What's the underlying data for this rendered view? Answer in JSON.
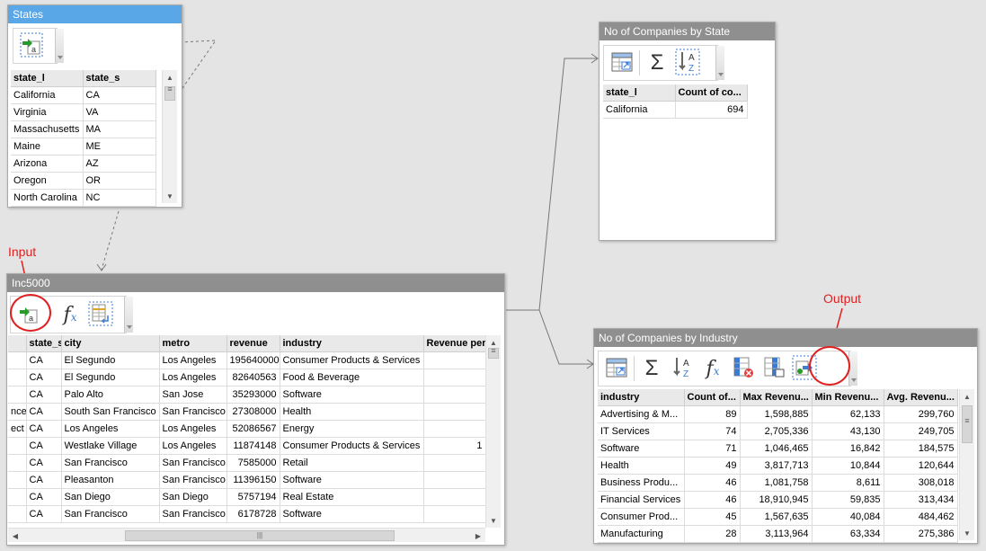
{
  "states_panel": {
    "title": "States",
    "columns": [
      "state_l",
      "state_s"
    ],
    "rows": [
      [
        "California",
        "CA"
      ],
      [
        "Virginia",
        "VA"
      ],
      [
        "Massachusetts",
        "MA"
      ],
      [
        "Maine",
        "ME"
      ],
      [
        "Arizona",
        "AZ"
      ],
      [
        "Oregon",
        "OR"
      ],
      [
        "North Carolina",
        "NC"
      ]
    ]
  },
  "inc_panel": {
    "title": "Inc5000",
    "columns": [
      "",
      "state_s",
      "city",
      "metro",
      "revenue",
      "industry",
      "Revenue per"
    ],
    "rows": [
      [
        "",
        "CA",
        "El Segundo",
        "Los Angeles",
        "195640000",
        "Consumer Products & Services",
        ""
      ],
      [
        "",
        "CA",
        "El Segundo",
        "Los Angeles",
        "82640563",
        "Food & Beverage",
        ""
      ],
      [
        "",
        "CA",
        "Palo Alto",
        "San Jose",
        "35293000",
        "Software",
        ""
      ],
      [
        "nce",
        "CA",
        "South San Francisco",
        "San Francisco",
        "27308000",
        "Health",
        ""
      ],
      [
        "ect",
        "CA",
        "Los Angeles",
        "Los Angeles",
        "52086567",
        "Energy",
        ""
      ],
      [
        "",
        "CA",
        "Westlake Village",
        "Los Angeles",
        "11874148",
        "Consumer Products & Services",
        "1"
      ],
      [
        "",
        "CA",
        "San Francisco",
        "San Francisco",
        "7585000",
        "Retail",
        ""
      ],
      [
        "",
        "CA",
        "Pleasanton",
        "San Francisco",
        "11396150",
        "Software",
        ""
      ],
      [
        "",
        "CA",
        "San Diego",
        "San Diego",
        "5757194",
        "Real Estate",
        ""
      ],
      [
        "",
        "CA",
        "San Francisco",
        "San Francisco",
        "6178728",
        "Software",
        ""
      ]
    ],
    "scroll_grip": "|||"
  },
  "by_state_panel": {
    "title": "No of Companies by State",
    "columns": [
      "state_l",
      "Count of co..."
    ],
    "rows": [
      [
        "California",
        "694"
      ]
    ]
  },
  "by_industry_panel": {
    "title": "No of Companies by Industry",
    "columns": [
      "industry",
      "Count of...",
      "Max Revenu...",
      "Min Revenu...",
      "Avg. Revenu..."
    ],
    "rows": [
      [
        "Advertising & M...",
        "89",
        "1,598,885",
        "62,133",
        "299,760"
      ],
      [
        "IT Services",
        "74",
        "2,705,336",
        "43,130",
        "249,705"
      ],
      [
        "Software",
        "71",
        "1,046,465",
        "16,842",
        "184,575"
      ],
      [
        "Health",
        "49",
        "3,817,713",
        "10,844",
        "120,644"
      ],
      [
        "Business Produ...",
        "46",
        "1,081,758",
        "8,611",
        "308,018"
      ],
      [
        "Financial Services",
        "46",
        "18,910,945",
        "59,835",
        "313,434"
      ],
      [
        "Consumer Prod...",
        "45",
        "1,567,635",
        "40,084",
        "484,462"
      ],
      [
        "Manufacturing",
        "28",
        "3,113,964",
        "63,334",
        "275,386"
      ]
    ]
  },
  "annotations": {
    "input_label": "Input",
    "output_label": "Output"
  },
  "icons": {
    "sigma": "Σ",
    "fx": "f",
    "fx_sub": "x",
    "sort_a": "A",
    "sort_z": "Z",
    "import_letter": "a"
  },
  "colors": {
    "active_title": "#5aa7e8",
    "inactive_title": "#8f8f8f",
    "annotation": "#e02020"
  }
}
